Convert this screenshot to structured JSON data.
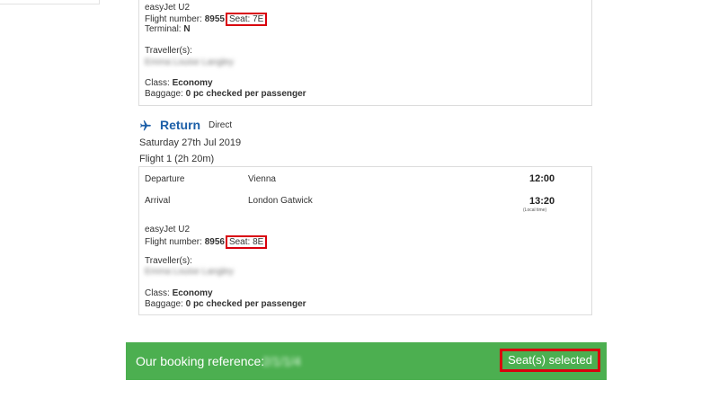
{
  "outbound": {
    "airline": "easyJet U2",
    "flight_number_label": "Flight number:",
    "flight_number": "8955",
    "seat": "Seat: 7E",
    "terminal_label": "Terminal:",
    "terminal": "N",
    "travellers_label": "Traveller(s):",
    "traveller_name": "Emma Louise Langley",
    "class_label": "Class:",
    "class_value": "Economy",
    "baggage_label": "Baggage:",
    "baggage_value": "0 pc checked per passenger"
  },
  "return": {
    "title": "Return",
    "type": "Direct",
    "date": "Saturday 27th Jul 2019",
    "flight": "Flight 1 (2h 20m)",
    "departure_label": "Departure",
    "departure_city": "Vienna",
    "departure_time": "12:00",
    "arrival_label": "Arrival",
    "arrival_city": "London Gatwick",
    "arrival_time": "13:20",
    "local_time": "(Local time)",
    "airline": "easyJet U2",
    "flight_number_label": "Flight number:",
    "flight_number": "8956",
    "seat": "Seat: 8E",
    "travellers_label": "Traveller(s):",
    "traveller_name": "Emma Louise Langley",
    "class_label": "Class:",
    "class_value": "Economy",
    "baggage_label": "Baggage:",
    "baggage_value": "0 pc checked per passenger"
  },
  "footer": {
    "booking_label": "Our booking reference:",
    "booking_ref": "2/1/1/4",
    "seats_selected": "Seat(s) selected"
  },
  "icons": {
    "return_plane": "airplane-icon"
  },
  "colors": {
    "accent_blue": "#1c5fa8",
    "footer_green": "#4caf50",
    "highlight_red": "#d9000d"
  }
}
